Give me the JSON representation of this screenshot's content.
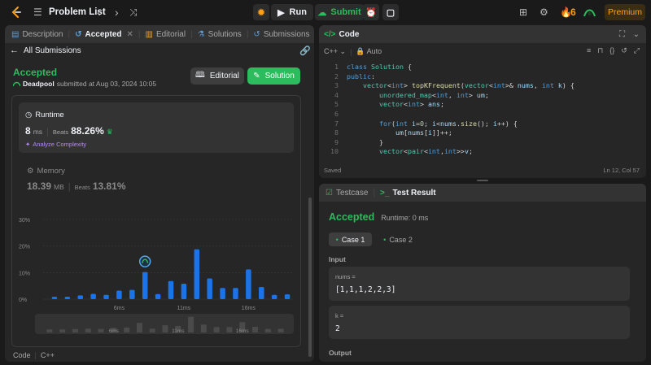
{
  "topbar": {
    "problem_list": "Problem List",
    "run": "Run",
    "submit": "Submit",
    "streak": "6",
    "premium": "Premium"
  },
  "left": {
    "tabs": [
      "Description",
      "Accepted",
      "Editorial",
      "Solutions",
      "Submissions"
    ],
    "all_submissions": "All Submissions",
    "status": "Accepted",
    "user": "Deadpool",
    "submitted_text": "submitted at Aug 03, 2024 10:05",
    "editorial_btn": "Editorial",
    "solution_btn": "Solution",
    "runtime": {
      "label": "Runtime",
      "value": "8",
      "unit": "ms",
      "beats_label": "Beats",
      "beats": "88.26%",
      "analyze": "Analyze Complexity"
    },
    "memory": {
      "label": "Memory",
      "value": "18.39",
      "unit": "MB",
      "beats_label": "Beats",
      "beats": "13.81%"
    },
    "code_footer": "Code",
    "code_lang": "C++"
  },
  "chart_data": {
    "type": "bar",
    "ylim": [
      0,
      30
    ],
    "yticks": [
      "30%",
      "20%",
      "10%",
      "0%"
    ],
    "yvalues": [
      30,
      20,
      10,
      0
    ],
    "xticks": [
      "6ms",
      "11ms",
      "16ms"
    ],
    "xtick_index": [
      5,
      10,
      15
    ],
    "values": [
      0.9,
      0.9,
      1.4,
      2.0,
      1.6,
      3.2,
      3.5,
      10.2,
      1.9,
      6.8,
      5.8,
      18.8,
      7.8,
      4.2,
      4.2,
      11.2,
      4.6,
      1.6,
      1.8
    ],
    "highlight_index": 7
  },
  "code": {
    "tab": "Code",
    "lang": "C++",
    "mode": "Auto",
    "saved": "Saved",
    "cursor": "Ln 12, Col 57",
    "lines": [
      "class Solution {",
      "public:",
      "    vector<int> topKFrequent(vector<int>& nums, int k) {",
      "        unordered_map<int, int> um;",
      "        vector<int> ans;",
      "",
      "        for(int i=0; i<nums.size(); i++) {",
      "            um[nums[i]]++;",
      "        }",
      "        vector<pair<int,int>>v;"
    ]
  },
  "test": {
    "testcase_tab": "Testcase",
    "result_tab": "Test Result",
    "status": "Accepted",
    "runtime": "Runtime: 0 ms",
    "case1": "Case 1",
    "case2": "Case 2",
    "input_label": "Input",
    "nums_label": "nums =",
    "nums_value": "[1,1,1,2,2,3]",
    "k_label": "k =",
    "k_value": "2",
    "output_label": "Output"
  }
}
